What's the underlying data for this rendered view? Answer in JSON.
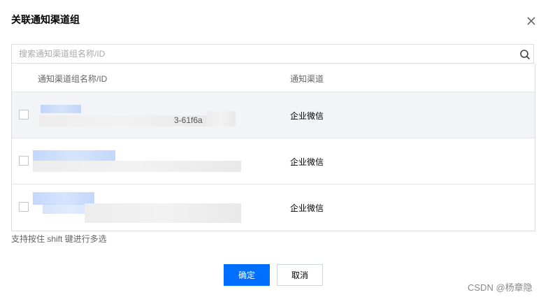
{
  "dialog": {
    "title": "关联通知渠道组",
    "close_icon": "close-icon"
  },
  "search": {
    "placeholder": "搜索通知渠道组名称/ID",
    "value": "",
    "icon": "search-icon"
  },
  "table": {
    "columns": [
      "通知渠道组名称/ID",
      "通知渠道"
    ],
    "rows": [
      {
        "id_fragment": "3-61f6a",
        "channel": "企业微信",
        "checked": false
      },
      {
        "id_fragment": "",
        "channel": "企业微信",
        "checked": false
      },
      {
        "id_fragment": "",
        "channel": "企业微信",
        "checked": false
      }
    ]
  },
  "hint": "支持按住 shift 键进行多选",
  "buttons": {
    "confirm": "确定",
    "cancel": "取消"
  },
  "watermark": "CSDN @杨章隐",
  "colors": {
    "primary": "#006eff",
    "border": "#dcdcdc",
    "row_hover": "#f3f4f7"
  }
}
